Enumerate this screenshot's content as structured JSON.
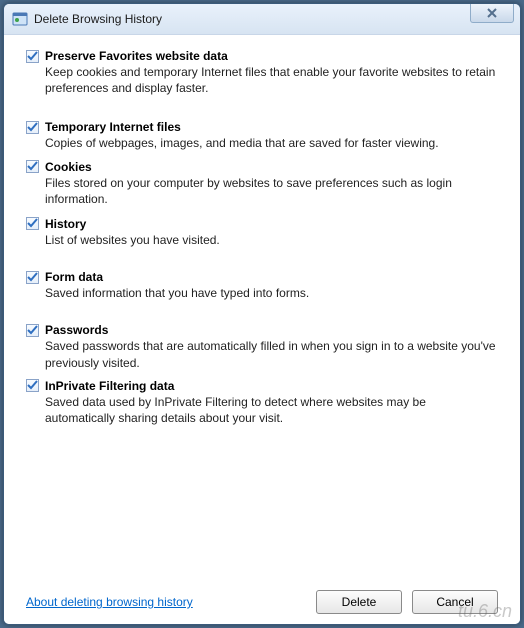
{
  "window": {
    "title": "Delete Browsing History"
  },
  "options": [
    {
      "key": "preserve",
      "checked": true,
      "label": "Preserve Favorites website data",
      "desc": "Keep cookies and temporary Internet files that enable your favorite websites to retain preferences and display faster."
    },
    {
      "key": "tempfiles",
      "checked": true,
      "label": "Temporary Internet files",
      "desc": "Copies of webpages, images, and media that are saved for faster viewing."
    },
    {
      "key": "cookies",
      "checked": true,
      "label": "Cookies",
      "desc": "Files stored on your computer by websites to save preferences such as login information."
    },
    {
      "key": "history",
      "checked": true,
      "label": "History",
      "desc": "List of websites you have visited."
    },
    {
      "key": "formdata",
      "checked": true,
      "label": "Form data",
      "desc": "Saved information that you have typed into forms."
    },
    {
      "key": "passwords",
      "checked": true,
      "label": "Passwords",
      "desc": "Saved passwords that are automatically filled in when you sign in to a website you've previously visited."
    },
    {
      "key": "inprivate",
      "checked": true,
      "label": "InPrivate Filtering data",
      "desc": "Saved data used by InPrivate Filtering to detect where websites may be automatically sharing details about your visit."
    }
  ],
  "footer": {
    "help_link": "About deleting browsing history",
    "delete_label": "Delete",
    "cancel_label": "Cancel"
  },
  "watermark": "tu.6.cn"
}
